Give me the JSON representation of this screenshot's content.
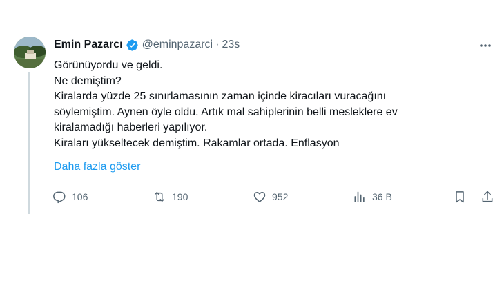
{
  "tweet": {
    "author_name": "Emin Pazarcı",
    "handle": "@eminpazarci",
    "separator": "·",
    "time": "23s",
    "lines": [
      "Görünüyordu ve geldi.",
      "Ne demiştim?",
      "Kiralarda yüzde 25 sınırlamasının zaman içinde kiracıları vuracağını",
      "söylemiştim. Aynen öyle oldu. Artık mal sahiplerinin belli mesleklere ev",
      "kiralamadığı haberleri yapılıyor.",
      "Kiraları yükseltecek demiştim. Rakamlar ortada. Enflasyon"
    ],
    "show_more": "Daha fazla göster"
  },
  "actions": {
    "replies": "106",
    "retweets": "190",
    "likes": "952",
    "views": "36 B"
  },
  "colors": {
    "accent": "#1d9bf0",
    "muted": "#536471",
    "text": "#0f1419",
    "thread_line": "#cfd9de"
  },
  "icons": {
    "verified": "verified-badge-icon",
    "more": "more-horizontal-icon",
    "reply": "reply-icon",
    "retweet": "retweet-icon",
    "like": "heart-icon",
    "views": "views-chart-icon",
    "bookmark": "bookmark-icon",
    "share": "share-icon"
  }
}
